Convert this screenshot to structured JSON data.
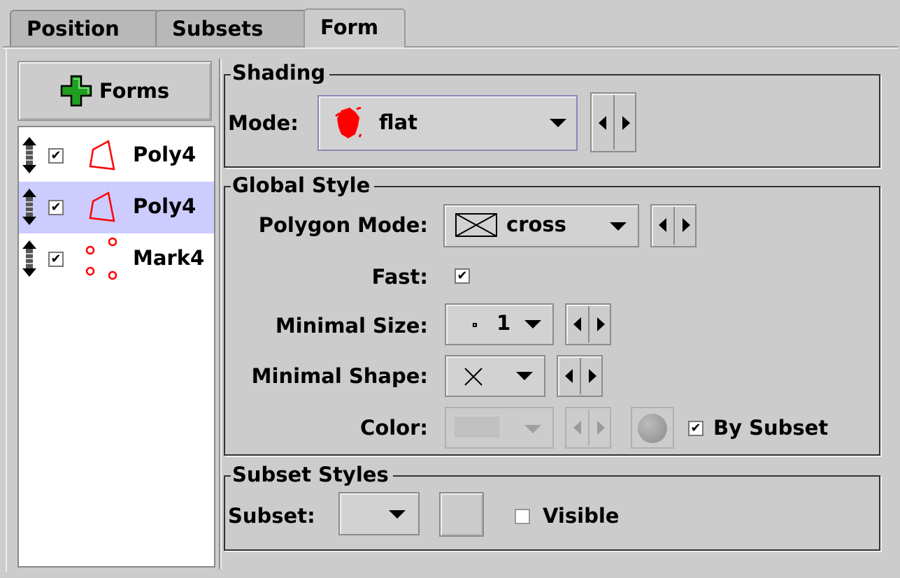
{
  "tabs": [
    {
      "label": "Position"
    },
    {
      "label": "Subsets"
    },
    {
      "label": "Form"
    }
  ],
  "forms_button": {
    "label": "Forms",
    "icon": "plus-icon"
  },
  "layers": [
    {
      "label": "Poly4",
      "checked": true,
      "icon": "polygon-icon",
      "selected": false
    },
    {
      "label": "Poly4",
      "checked": true,
      "icon": "polygon-icon",
      "selected": true
    },
    {
      "label": "Mark4",
      "checked": true,
      "icon": "markers-icon",
      "selected": false
    }
  ],
  "shading": {
    "title": "Shading",
    "mode_label": "Mode:",
    "mode_value": "flat"
  },
  "global_style": {
    "title": "Global Style",
    "polygon_mode_label": "Polygon Mode:",
    "polygon_mode_value": "cross",
    "fast_label": "Fast:",
    "fast_checked": true,
    "minimal_size_label": "Minimal Size:",
    "minimal_size_value": "1",
    "minimal_shape_label": "Minimal Shape:",
    "color_label": "Color:",
    "by_subset_label": "By Subset",
    "by_subset_checked": true
  },
  "subset_styles": {
    "title": "Subset Styles",
    "subset_label": "Subset:",
    "visible_label": "Visible",
    "visible_checked": false
  },
  "colors": {
    "accent_red": "#ff0000",
    "selection": "#ccccff",
    "plus_green": "#22aa22"
  }
}
